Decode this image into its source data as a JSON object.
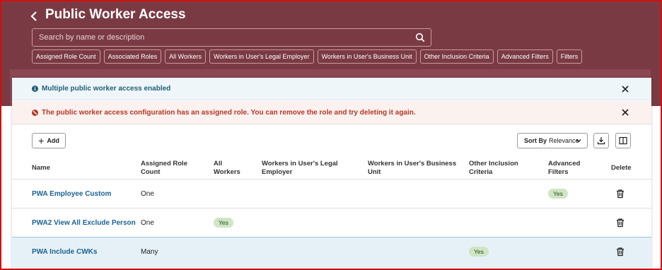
{
  "header": {
    "back_label": "<",
    "title": "Public Worker Access"
  },
  "search": {
    "placeholder": "Search by name or description"
  },
  "filter_chips": [
    "Assigned Role Count",
    "Associated Roles",
    "All Workers",
    "Workers in User's Legal Employer",
    "Workers in User's Business Unit",
    "Other Inclusion Criteria",
    "Advanced Filters",
    "Filters"
  ],
  "banners": {
    "info": "Multiple public worker access enabled",
    "error": "The public worker access configuration has an assigned role. You can remove the role and try deleting it again."
  },
  "toolbar": {
    "add_label": "Add",
    "sort_prefix": "Sort By",
    "sort_value": "Relevance"
  },
  "table": {
    "headers": {
      "name": "Name",
      "assigned_role_count": "Assigned Role Count",
      "all_workers": "All Workers",
      "legal_employer": "Workers in User's Legal Employer",
      "business_unit": "Workers in User's Business Unit",
      "other_criteria": "Other Inclusion Criteria",
      "advanced_filters": "Advanced Filters",
      "delete": "Delete"
    },
    "rows": [
      {
        "name": "PWA Employee Custom",
        "assigned_role_count": "One",
        "all_workers": "",
        "other_criteria": "",
        "advanced_filters": "Yes"
      },
      {
        "name": "PWA2 View All Exclude Person",
        "assigned_role_count": "One",
        "all_workers": "Yes",
        "other_criteria": "",
        "advanced_filters": ""
      },
      {
        "name": "PWA Include CWKs",
        "assigned_role_count": "Many",
        "all_workers": "",
        "other_criteria": "Yes",
        "advanced_filters": ""
      }
    ]
  },
  "colors": {
    "header_bg": "#7a3a44",
    "link": "#1b6290",
    "error": "#b53727",
    "info": "#235e78",
    "badge_bg": "#cfe5c4"
  }
}
